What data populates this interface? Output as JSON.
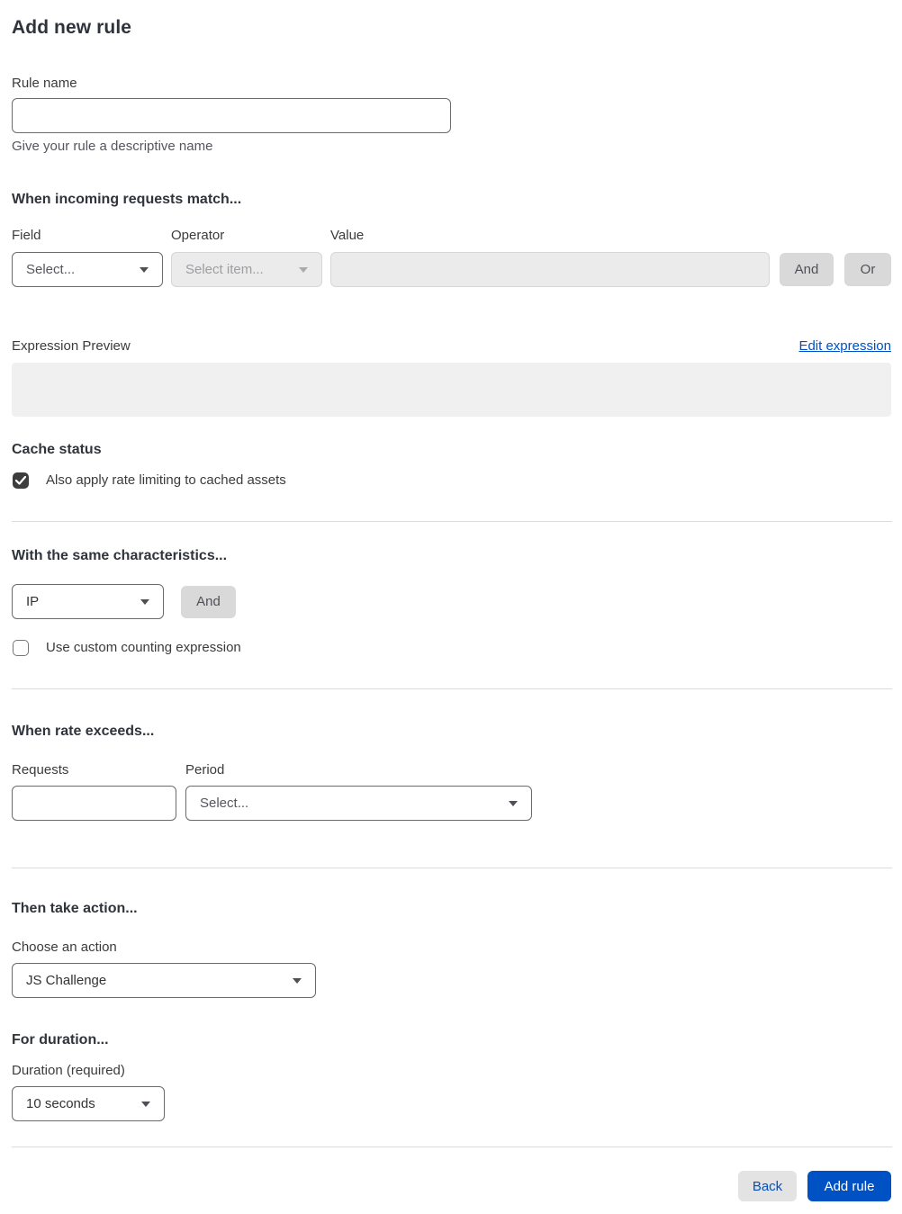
{
  "page": {
    "title": "Add new rule"
  },
  "rule_name": {
    "label": "Rule name",
    "value": "",
    "placeholder": "",
    "helper": "Give your rule a descriptive name"
  },
  "match_section": {
    "heading": "When incoming requests match...",
    "field": {
      "label": "Field",
      "selected": "Select..."
    },
    "operator": {
      "label": "Operator",
      "selected": "Select item...",
      "disabled": true
    },
    "value": {
      "label": "Value",
      "value": "",
      "disabled": true
    },
    "and_button": "And",
    "or_button": "Or",
    "expression_preview_label": "Expression Preview",
    "edit_expression_link": "Edit expression",
    "expression_preview_value": ""
  },
  "cache_section": {
    "heading": "Cache status",
    "checkbox_label": "Also apply rate limiting to cached assets",
    "checked": true
  },
  "characteristics_section": {
    "heading": "With the same characteristics...",
    "characteristic_selected": "IP",
    "and_button": "And",
    "checkbox_label": "Use custom counting expression",
    "checked": false
  },
  "rate_section": {
    "heading": "When rate exceeds...",
    "requests": {
      "label": "Requests",
      "value": ""
    },
    "period": {
      "label": "Period",
      "selected": "Select..."
    }
  },
  "action_section": {
    "heading": "Then take action...",
    "label": "Choose an action",
    "selected": "JS Challenge"
  },
  "duration_section": {
    "heading": "For duration...",
    "label": "Duration (required)",
    "selected": "10 seconds"
  },
  "footer": {
    "back_button": "Back",
    "add_rule_button": "Add rule"
  },
  "colors": {
    "accent_blue": "#0051c3",
    "checkbox_checked": "#3d3d3d",
    "disabled_background": "#ebebeb",
    "gray_button": "#d9d9d9"
  }
}
